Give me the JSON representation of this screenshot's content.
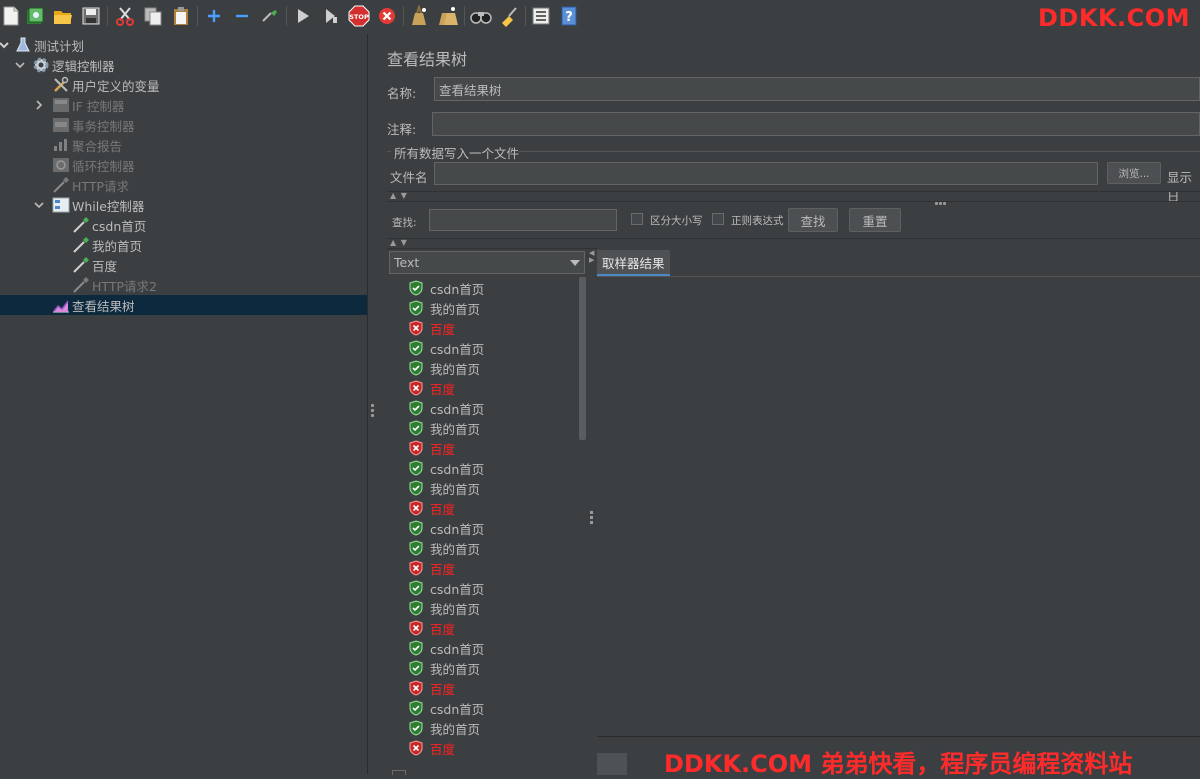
{
  "watermark_top": "DDKK.COM",
  "watermark_bottom": "DDKK.COM 弟弟快看，程序员编程资料站",
  "toolbar_icons": [
    "new-icon",
    "templates-icon",
    "open-icon",
    "save-icon",
    "cut-icon",
    "copy-icon",
    "paste-icon",
    "expand-icon",
    "collapse-icon",
    "toggle-icon",
    "start-icon",
    "start-no-pause-icon",
    "stop-icon",
    "shutdown-icon",
    "clear-icon",
    "clear-all-icon",
    "search-icon",
    "reset-search-icon",
    "function-helper-icon",
    "help-icon"
  ],
  "tree": {
    "items": [
      {
        "label": "测试计划",
        "icon": "test-plan-icon",
        "level": 0,
        "expanded": true,
        "disabled": false
      },
      {
        "label": "逻辑控制器",
        "icon": "gear-icon",
        "level": 1,
        "expanded": true,
        "disabled": false
      },
      {
        "label": "用户定义的变量",
        "icon": "wrench-icon",
        "level": 2,
        "disabled": false
      },
      {
        "label": "IF 控制器",
        "icon": "if-controller-icon",
        "level": 2,
        "collapsed": true,
        "disabled": true
      },
      {
        "label": "事务控制器",
        "icon": "transaction-controller-icon",
        "level": 2,
        "disabled": true
      },
      {
        "label": "聚合报告",
        "icon": "aggregate-report-icon",
        "level": 2,
        "disabled": true
      },
      {
        "label": "循环控制器",
        "icon": "loop-controller-icon",
        "level": 2,
        "disabled": true
      },
      {
        "label": "HTTP请求",
        "icon": "pipette-icon",
        "level": 2,
        "disabled": true
      },
      {
        "label": "While控制器",
        "icon": "while-controller-icon",
        "level": 2,
        "expanded": true,
        "disabled": false
      },
      {
        "label": "csdn首页",
        "icon": "pipette-icon",
        "level": 3,
        "disabled": false
      },
      {
        "label": "我的首页",
        "icon": "pipette-icon",
        "level": 3,
        "disabled": false
      },
      {
        "label": "百度",
        "icon": "pipette-icon",
        "level": 3,
        "disabled": false
      },
      {
        "label": "HTTP请求2",
        "icon": "pipette-icon",
        "level": 3,
        "disabled": true
      },
      {
        "label": "查看结果树",
        "icon": "chart-icon",
        "level": 2,
        "selected": true,
        "disabled": false
      }
    ]
  },
  "panel": {
    "title": "查看结果树",
    "name_label": "名称:",
    "name_value": "查看结果树",
    "comment_label": "注释:",
    "comment_value": "",
    "file_group_title": "所有数据写入一个文件",
    "filename_label": "文件名",
    "filename_value": "",
    "browse_label": "浏览...",
    "display_label": "显示日",
    "search_label": "查找:",
    "search_value": "",
    "case_label": "区分大小写",
    "regex_label": "正则表达式",
    "find_button": "查找",
    "reset_button": "重置",
    "renderer_selected": "Text",
    "detail_tab": "取样器结果"
  },
  "results": [
    {
      "label": "csdn首页",
      "status": "ok"
    },
    {
      "label": "我的首页",
      "status": "ok"
    },
    {
      "label": "百度",
      "status": "fail"
    },
    {
      "label": "csdn首页",
      "status": "ok"
    },
    {
      "label": "我的首页",
      "status": "ok"
    },
    {
      "label": "百度",
      "status": "fail"
    },
    {
      "label": "csdn首页",
      "status": "ok"
    },
    {
      "label": "我的首页",
      "status": "ok"
    },
    {
      "label": "百度",
      "status": "fail"
    },
    {
      "label": "csdn首页",
      "status": "ok"
    },
    {
      "label": "我的首页",
      "status": "ok"
    },
    {
      "label": "百度",
      "status": "fail"
    },
    {
      "label": "csdn首页",
      "status": "ok"
    },
    {
      "label": "我的首页",
      "status": "ok"
    },
    {
      "label": "百度",
      "status": "fail"
    },
    {
      "label": "csdn首页",
      "status": "ok"
    },
    {
      "label": "我的首页",
      "status": "ok"
    },
    {
      "label": "百度",
      "status": "fail"
    },
    {
      "label": "csdn首页",
      "status": "ok"
    },
    {
      "label": "我的首页",
      "status": "ok"
    },
    {
      "label": "百度",
      "status": "fail"
    },
    {
      "label": "csdn首页",
      "status": "ok"
    },
    {
      "label": "我的首页",
      "status": "ok"
    },
    {
      "label": "百度",
      "status": "fail"
    }
  ],
  "colors": {
    "background": "#3c3f41",
    "selected": "#0d293e",
    "ok": "#4cc24c",
    "fail": "#e02020",
    "accent": "#4a88c7"
  }
}
